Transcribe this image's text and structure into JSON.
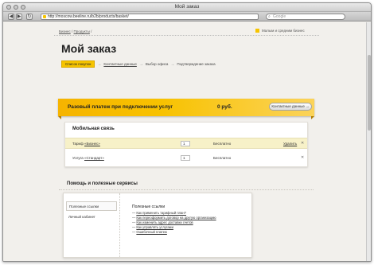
{
  "window": {
    "title": "Мой заказ"
  },
  "browser": {
    "url": "http://moscow.beeline.ru/b2b/products/basket/",
    "search_placeholder": "Google",
    "back": "◀",
    "forward": "▶",
    "reload": "↻"
  },
  "breadcrumb": {
    "item1": "Бизнес",
    "sep": " / ",
    "item2": "Продукты",
    "sep2": " / "
  },
  "topright_link": "Малым и средним бизнес",
  "page_title": "Мой заказ",
  "steps": [
    {
      "label": "Список покупок",
      "active": true
    },
    {
      "label": "Контактные данные"
    },
    {
      "label": "Выбор офиса"
    },
    {
      "label": "Подтверждение заказа"
    }
  ],
  "step_arrow": "→",
  "banner": {
    "title": "Разовый платеж при подключении услуг",
    "price": "0 руб.",
    "button": "Контактные данные →"
  },
  "cart": {
    "title": "Мобильная связь",
    "rows": [
      {
        "prefix": "Тариф ",
        "name": "«Бизнес»",
        "qty": "1",
        "price": "Бесплатно",
        "delete": "Удалить",
        "x": "✕"
      },
      {
        "prefix": "Услуга ",
        "name": "«Стандарт»",
        "qty": "1",
        "price": "Бесплатно",
        "x": "✕"
      }
    ]
  },
  "help": {
    "title": "Помощь и полезные сервисы",
    "tabs": [
      "Полезные ссылки",
      "Личный кабинет"
    ],
    "links_title": "Полезные ссылки",
    "links": [
      "Как применить тарифный план?",
      "Как переоформить договор на другую организацию",
      "Как изменить адрес доставки счетов",
      "Как управлять услугами",
      "Ошибочный платеж"
    ]
  },
  "colors": {
    "accent": "#f6c400",
    "highlight_row": "#f7f1c8"
  }
}
